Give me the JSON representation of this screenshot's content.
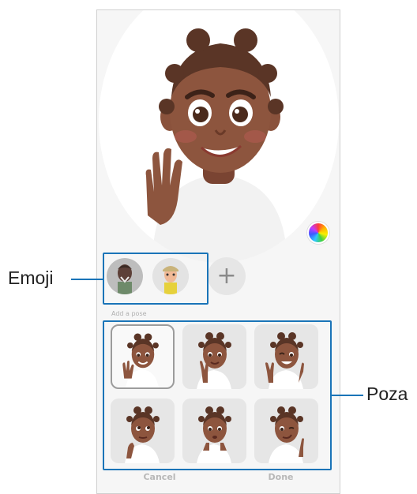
{
  "callouts": {
    "emoji_label": "Emoji",
    "pose_label": "Poza"
  },
  "preview": {
    "color_button_icon": "color-palette-icon"
  },
  "emoji_row": {
    "items": [
      {
        "name": "emoji-avatar-1",
        "selected": true
      },
      {
        "name": "emoji-avatar-2",
        "selected": false
      }
    ],
    "add_symbol": "+"
  },
  "section_label": "Add a pose",
  "poses": [
    {
      "name": "pose-wave",
      "selected": true
    },
    {
      "name": "pose-peace",
      "selected": false
    },
    {
      "name": "pose-wink-peace",
      "selected": false
    },
    {
      "name": "pose-think",
      "selected": false
    },
    {
      "name": "pose-shy",
      "selected": false
    },
    {
      "name": "pose-smirk",
      "selected": false
    }
  ],
  "bottom_bar": {
    "cancel_label": "Cancel",
    "done_label": "Done"
  },
  "colors": {
    "callout_blue": "#1a74b8",
    "skin": "#8a523c",
    "hair": "#5a3526",
    "shirt": "#ffffff"
  }
}
